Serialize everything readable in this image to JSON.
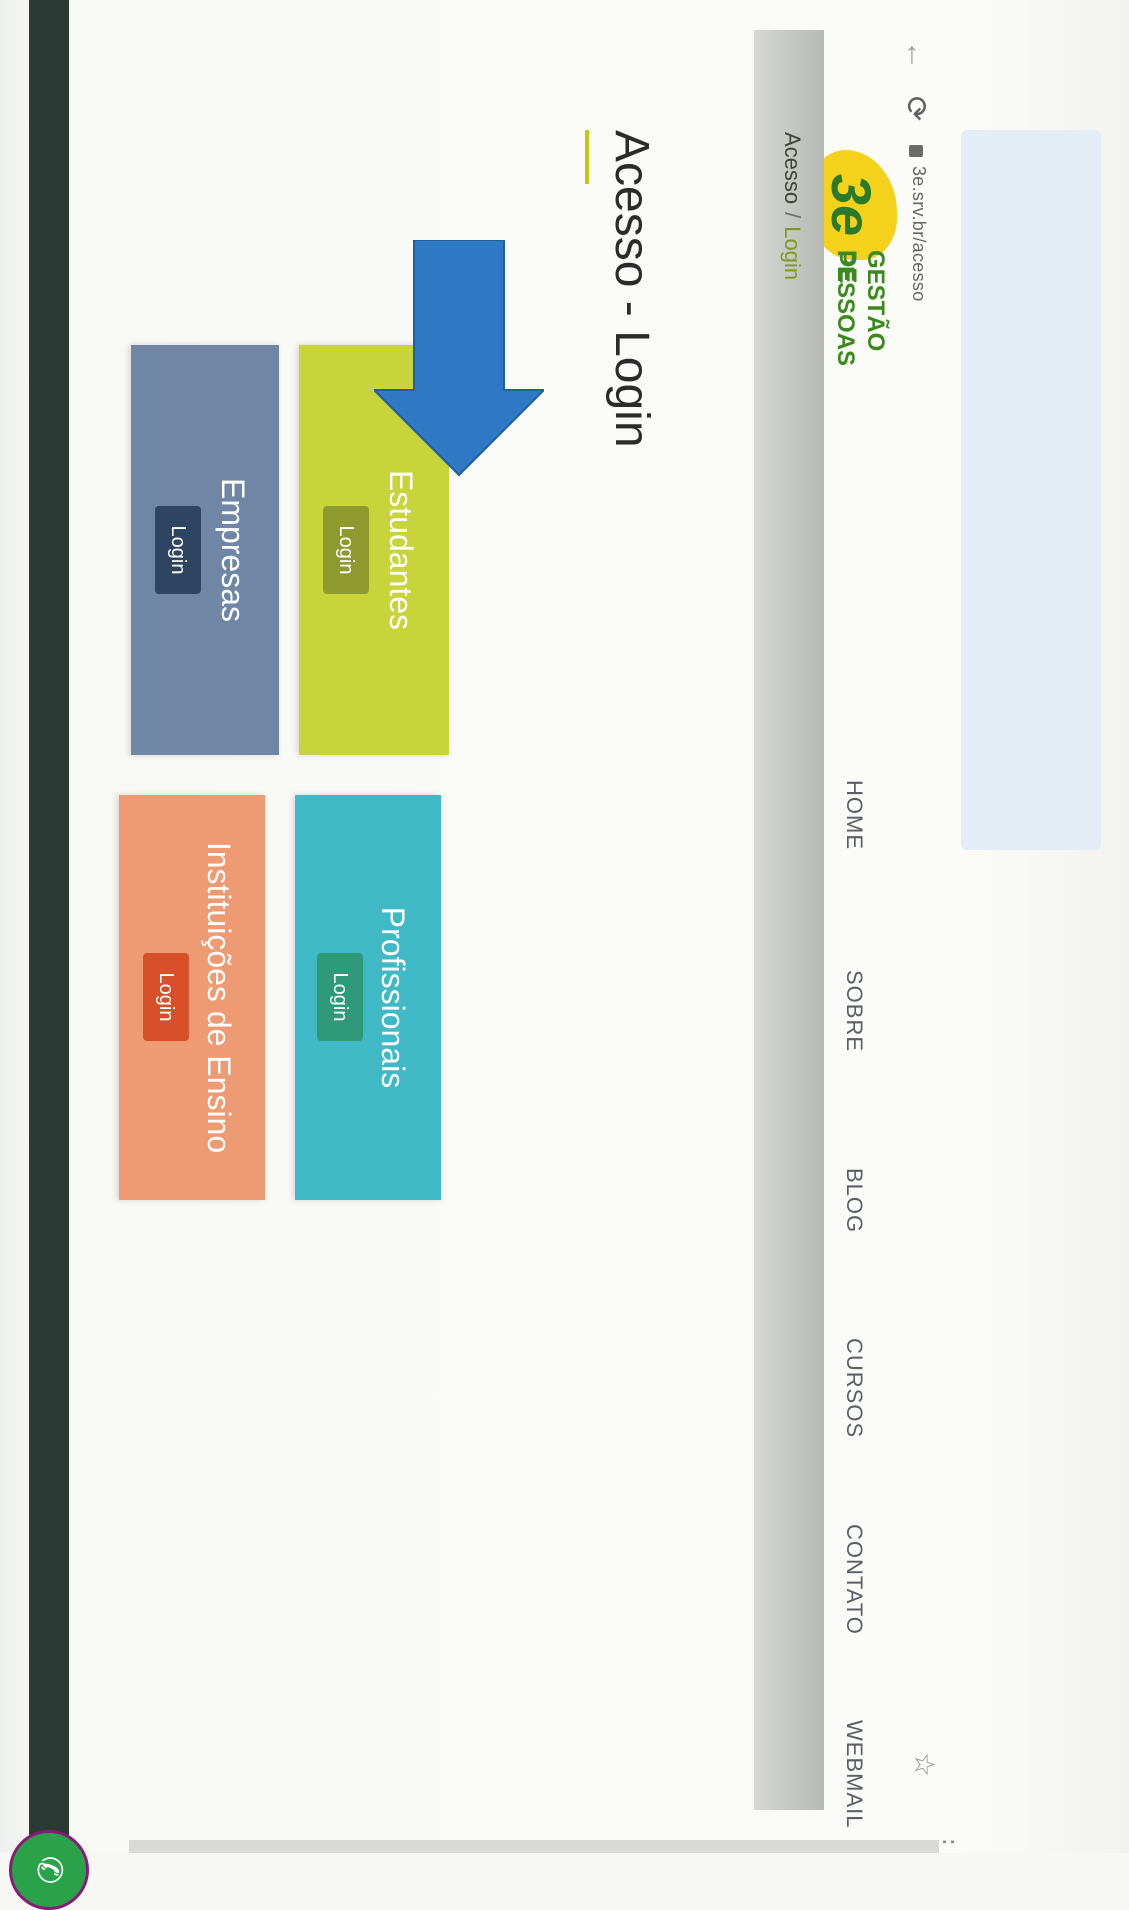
{
  "browser": {
    "url": "3e.srv.br/acesso",
    "back_icon": "←",
    "reload_icon": "⟳",
    "star_icon": "☆",
    "menu_icon": "⋮"
  },
  "logo": {
    "mark": "3e",
    "line1": "GESTÃO DE",
    "line2": "PESSOAS"
  },
  "nav": {
    "items": [
      "HOME",
      "SOBRE",
      "BLOG",
      "CURSOS",
      "CONTATO",
      "WEBMAIL"
    ]
  },
  "breadcrumb": {
    "root": "Acesso",
    "separator": "/",
    "current": "Login"
  },
  "page": {
    "title": "Acesso - Login"
  },
  "cards": [
    {
      "title": "Estudantes",
      "button": "Login",
      "bg": "#c7d43a",
      "btn_bg": "#8f9a2e"
    },
    {
      "title": "Profissionais",
      "button": "Login",
      "bg": "#3fb9c6",
      "btn_bg": "#2e9a78"
    },
    {
      "title": "Empresas",
      "button": "Login",
      "bg": "#6f86a5",
      "btn_bg": "#2e4562"
    },
    {
      "title": "Instituições de Ensino",
      "button": "Login",
      "bg": "#ee9a72",
      "btn_bg": "#d8502a"
    }
  ],
  "colors": {
    "arrow": "#2f78c4",
    "chat": "#2aa24a"
  },
  "chat_icon": "✆"
}
